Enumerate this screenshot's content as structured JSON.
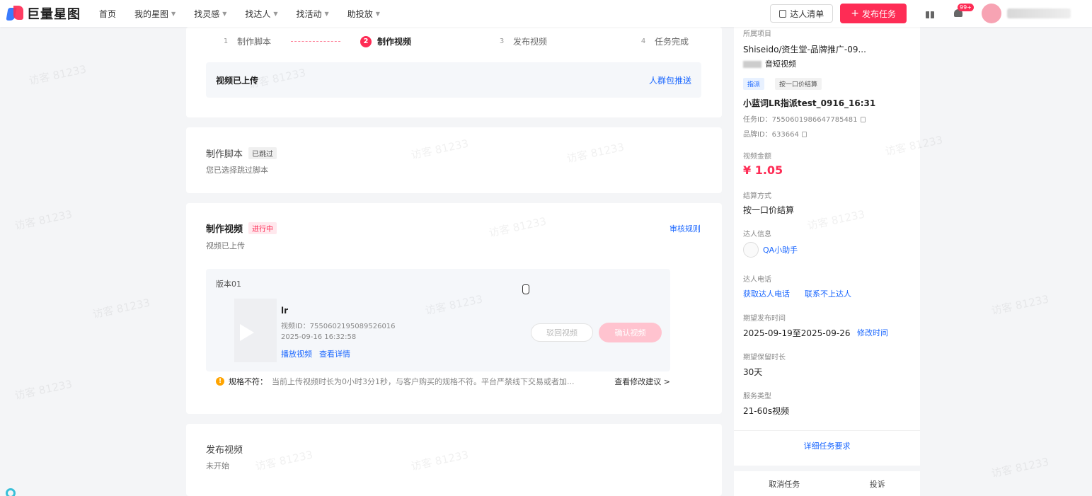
{
  "app": {
    "logo_text": "巨量星图"
  },
  "nav": {
    "items": [
      {
        "label": "首页",
        "dropdown": false
      },
      {
        "label": "我的星图",
        "dropdown": true
      },
      {
        "label": "找灵感",
        "dropdown": true
      },
      {
        "label": "找达人",
        "dropdown": true
      },
      {
        "label": "找活动",
        "dropdown": true
      },
      {
        "label": "助投放",
        "dropdown": true
      }
    ],
    "talent_list_label": "达人清单",
    "publish_label": "发布任务",
    "notification_badge": "99+"
  },
  "steps": [
    {
      "num": "1",
      "label": "制作脚本"
    },
    {
      "num": "2",
      "label": "制作视频"
    },
    {
      "num": "3",
      "label": "发布视频"
    },
    {
      "num": "4",
      "label": "任务完成"
    }
  ],
  "upload_bar": {
    "status": "视频已上传",
    "link": "人群包推送"
  },
  "script_section": {
    "title": "制作脚本",
    "tag": "已跳过",
    "desc": "您已选择跳过脚本"
  },
  "video_section": {
    "title": "制作视频",
    "tag": "进行中",
    "desc": "视频已上传",
    "review_link": "审核规则",
    "version_label": "版本01",
    "video": {
      "name": "lr",
      "id": "视频ID：7550602195089526016",
      "time": "2025-09-16 16:32:58",
      "play_link": "播放视频",
      "detail_link": "查看详情"
    },
    "reject_label": "驳回视频",
    "confirm_label": "确认视频",
    "warning": {
      "label": "规格不符：",
      "text": "当前上传视频时长为0小时3分1秒，与客户购买的规格不符。平台严禁线下交易或者加...",
      "link": "查看修改建议 >"
    }
  },
  "publish_section": {
    "title": "发布视频",
    "desc": "未开始"
  },
  "side": {
    "project_label": "所属项目",
    "project_value": "Shiseido/资生堂-品牌推广-09...",
    "type_value": "音短视频",
    "tag_assign": "指派",
    "tag_price": "按一口价结算",
    "task_name": "小蓝词LR指派test_0916_16:31",
    "task_id": "任务ID：7550601986647785481",
    "brand_id": "品牌ID：633664",
    "amount_label": "视频金额",
    "amount_value": "¥ 1.05",
    "settle_label": "结算方式",
    "settle_value": "按一口价结算",
    "talent_label": "达人信息",
    "talent_name": "QA小助手",
    "phone_label": "达人电话",
    "phone_get": "获取达人电话",
    "phone_unreachable": "联系不上达人",
    "publish_time_label": "期望发布时间",
    "publish_time_value": "2025-09-19至2025-09-26",
    "modify_time": "修改时间",
    "retain_label": "期望保留时长",
    "retain_value": "30天",
    "service_label": "服务类型",
    "service_value": "21-60s视频",
    "detail_link": "详细任务要求",
    "cancel_label": "取消任务",
    "complain_label": "投诉"
  },
  "watermark": "访客 81233",
  "colors": {
    "brand": "#fe2c55",
    "link": "#1966ff"
  }
}
